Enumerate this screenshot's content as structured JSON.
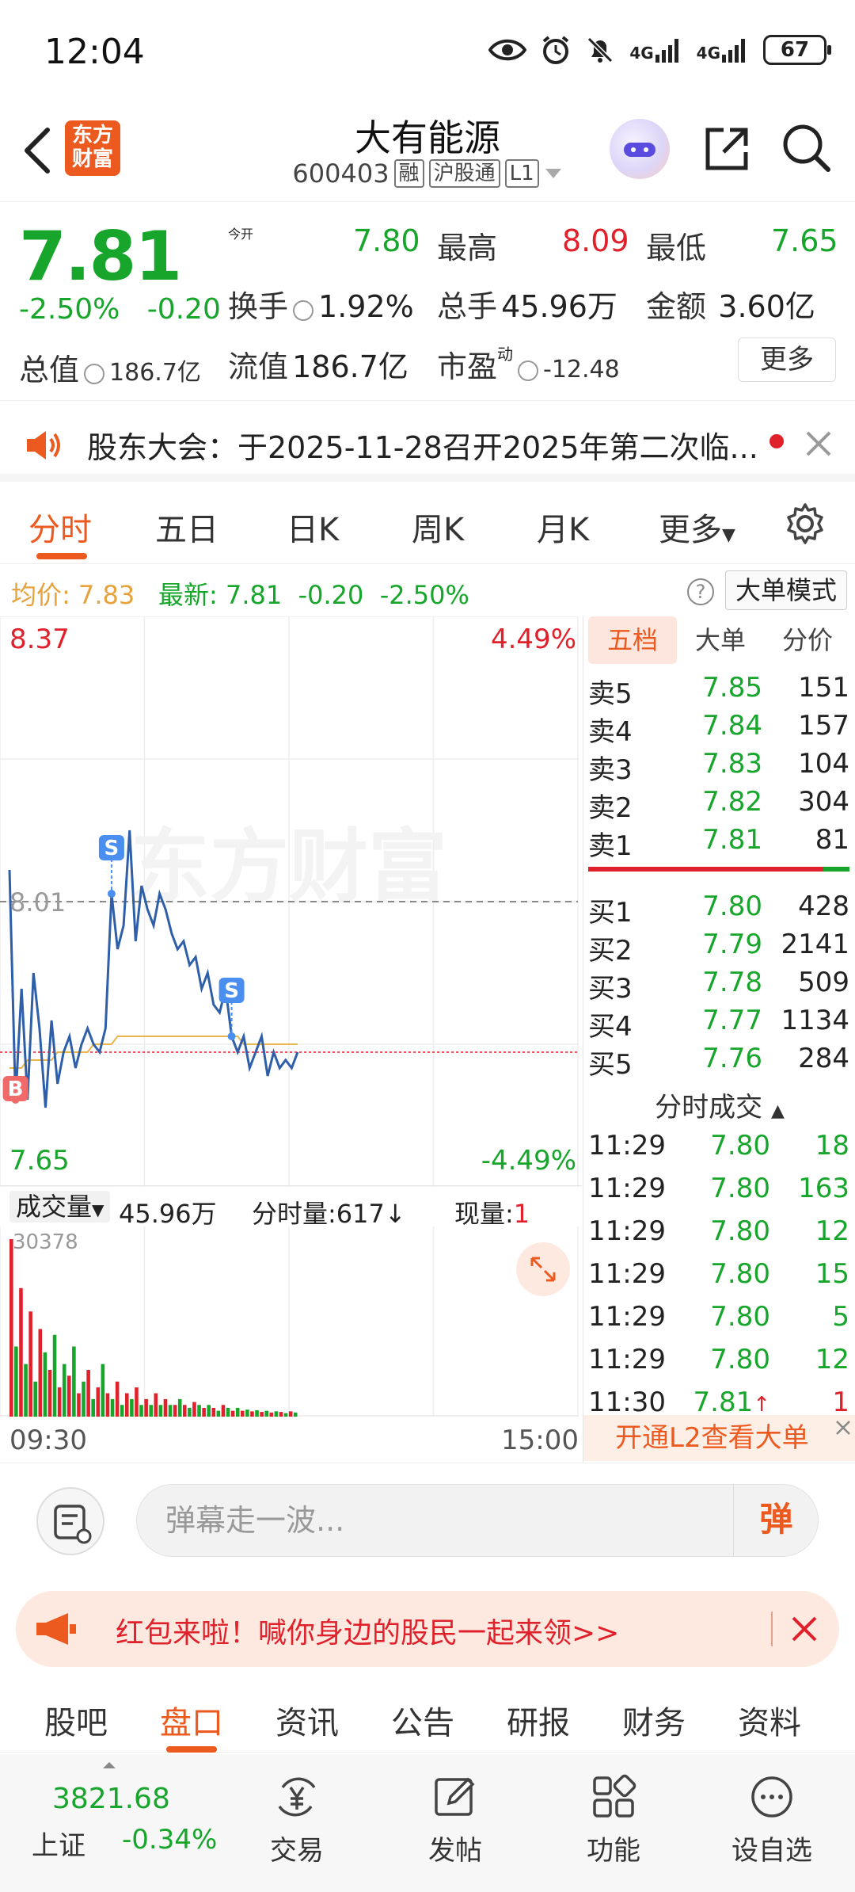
{
  "status": {
    "time": "12:04",
    "battery": "67",
    "net1": "4G",
    "net2": "4G"
  },
  "header": {
    "logo": "东方财富",
    "name": "大有能源",
    "code": "600403",
    "tags": [
      "融",
      "沪股通",
      "L1"
    ]
  },
  "quote": {
    "price": "7.81",
    "change_pct": "-2.50%",
    "change": "-0.20",
    "open_label": "今开",
    "open": "7.80",
    "high_label": "最高",
    "high": "8.09",
    "low_label": "最低",
    "low": "7.65",
    "turnover_label": "换手",
    "turnover": "1.92%",
    "volume_label": "总手",
    "volume": "45.96万",
    "amount_label": "金额",
    "amount": "3.60亿",
    "mktcap_label": "总值",
    "mktcap": "186.7亿",
    "float_label": "流值",
    "float": "186.7亿",
    "pe_label": "市盈",
    "pe_sup": "动",
    "pe": "-12.48",
    "more": "更多"
  },
  "notice": {
    "text": "股东大会：于2025-11-28召开2025年第二次临..."
  },
  "chart_tabs": [
    "分时",
    "五日",
    "日K",
    "周K",
    "月K",
    "更多"
  ],
  "infobar": {
    "avg_label": "均价:",
    "avg": "7.83",
    "latest_label": "最新:",
    "latest": "7.81",
    "change": "-0.20",
    "change_pct": "-2.50%",
    "help": "?",
    "big_order_mode": "大单模式"
  },
  "chart": {
    "y_high": "8.37",
    "y_low": "7.65",
    "pct_high": "4.49%",
    "pct_low": "-4.49%",
    "prev_close": "8.01",
    "watermark": "东方财富",
    "marker_s": "S",
    "marker_b": "B"
  },
  "chart_data": {
    "type": "line",
    "title": "",
    "ylim": [
      7.65,
      8.37
    ],
    "prev_close": 8.01,
    "series": [
      {
        "name": "",
        "values": [
          8.05,
          7.76,
          7.9,
          7.76,
          7.92,
          7.85,
          7.75,
          7.86,
          7.78,
          7.82,
          7.84,
          7.8,
          7.83,
          7.85,
          7.83,
          7.82,
          7.85,
          8.02,
          7.95,
          7.98,
          8.1,
          7.96,
          8.03,
          8.0,
          7.98,
          8.02,
          8.0,
          7.97,
          7.95,
          7.96,
          7.93,
          7.94,
          7.9,
          7.92,
          7.88,
          7.87,
          7.9,
          7.84,
          7.82,
          7.84,
          7.8,
          7.82,
          7.84,
          7.79,
          7.82,
          7.8,
          7.81,
          7.8,
          7.82
        ]
      },
      {
        "name": "",
        "values": [
          7.8,
          7.8,
          7.8,
          7.81,
          7.81,
          7.81,
          7.81,
          7.81,
          7.82,
          7.82,
          7.82,
          7.82,
          7.82,
          7.82,
          7.83,
          7.83,
          7.83,
          7.83,
          7.84,
          7.84,
          7.84,
          7.84,
          7.84,
          7.84,
          7.84,
          7.84,
          7.84,
          7.84,
          7.84,
          7.84,
          7.84,
          7.84,
          7.84,
          7.84,
          7.84,
          7.84,
          7.84,
          7.84,
          7.84,
          7.83,
          7.83,
          7.83,
          7.83,
          7.83,
          7.83,
          7.83,
          7.83,
          7.83,
          7.83
        ]
      }
    ],
    "volume": {
      "max_label": "30378",
      "values": [
        30378,
        12000,
        22000,
        9000,
        18000,
        6000,
        15000,
        11000,
        8000,
        14000,
        5000,
        9000,
        7000,
        12000,
        4000,
        6000,
        8000,
        3000,
        5000,
        9000,
        4000,
        3000,
        6000,
        2000,
        4000,
        3000,
        5000,
        2000,
        3000,
        2000,
        4000,
        2000,
        3000,
        2000,
        2000,
        3000,
        2000,
        1500,
        2500,
        2000,
        1500,
        2000,
        1500,
        1000,
        2000,
        1500,
        1000,
        1500,
        1000,
        1200,
        900,
        1100,
        800,
        1000,
        700,
        900,
        800,
        600,
        900,
        700
      ]
    }
  },
  "volume_bar": {
    "label": "成交量",
    "value": "45.96万",
    "per_label": "分时量:617",
    "current_label": "现量:",
    "current": "1"
  },
  "time_axis": {
    "start": "09:30",
    "end": "15:00"
  },
  "order_tabs": [
    "五档",
    "大单",
    "分价"
  ],
  "asks": [
    {
      "label": "卖5",
      "price": "7.85",
      "vol": "151"
    },
    {
      "label": "卖4",
      "price": "7.84",
      "vol": "157"
    },
    {
      "label": "卖3",
      "price": "7.83",
      "vol": "104"
    },
    {
      "label": "卖2",
      "price": "7.82",
      "vol": "304"
    },
    {
      "label": "卖1",
      "price": "7.81",
      "vol": "81"
    }
  ],
  "bids": [
    {
      "label": "买1",
      "price": "7.80",
      "vol": "428"
    },
    {
      "label": "买2",
      "price": "7.79",
      "vol": "2141"
    },
    {
      "label": "买3",
      "price": "7.78",
      "vol": "509"
    },
    {
      "label": "买4",
      "price": "7.77",
      "vol": "1134"
    },
    {
      "label": "买5",
      "price": "7.76",
      "vol": "284"
    }
  ],
  "ticks_title": "分时成交",
  "ticks": [
    {
      "time": "11:29",
      "price": "7.80",
      "vol": "18",
      "dir": ""
    },
    {
      "time": "11:29",
      "price": "7.80",
      "vol": "163",
      "dir": ""
    },
    {
      "time": "11:29",
      "price": "7.80",
      "vol": "12",
      "dir": ""
    },
    {
      "time": "11:29",
      "price": "7.80",
      "vol": "15",
      "dir": ""
    },
    {
      "time": "11:29",
      "price": "7.80",
      "vol": "5",
      "dir": ""
    },
    {
      "time": "11:29",
      "price": "7.80",
      "vol": "12",
      "dir": ""
    },
    {
      "time": "11:30",
      "price": "7.81",
      "vol": "1",
      "dir": "↑"
    }
  ],
  "l2_banner": "开通L2查看大单",
  "comment": {
    "placeholder": "弹幕走一波...",
    "send": "弹"
  },
  "redpacket": "红包来啦！喊你身边的股民一起来领>>",
  "bottom_tabs": [
    "股吧",
    "盘口",
    "资讯",
    "公告",
    "研报",
    "财务",
    "资料"
  ],
  "nav": {
    "index_value": "3821.68",
    "index_name": "上证",
    "index_change": "-0.34%",
    "trade": "交易",
    "post": "发帖",
    "function": "功能",
    "watchlist": "设自选"
  }
}
